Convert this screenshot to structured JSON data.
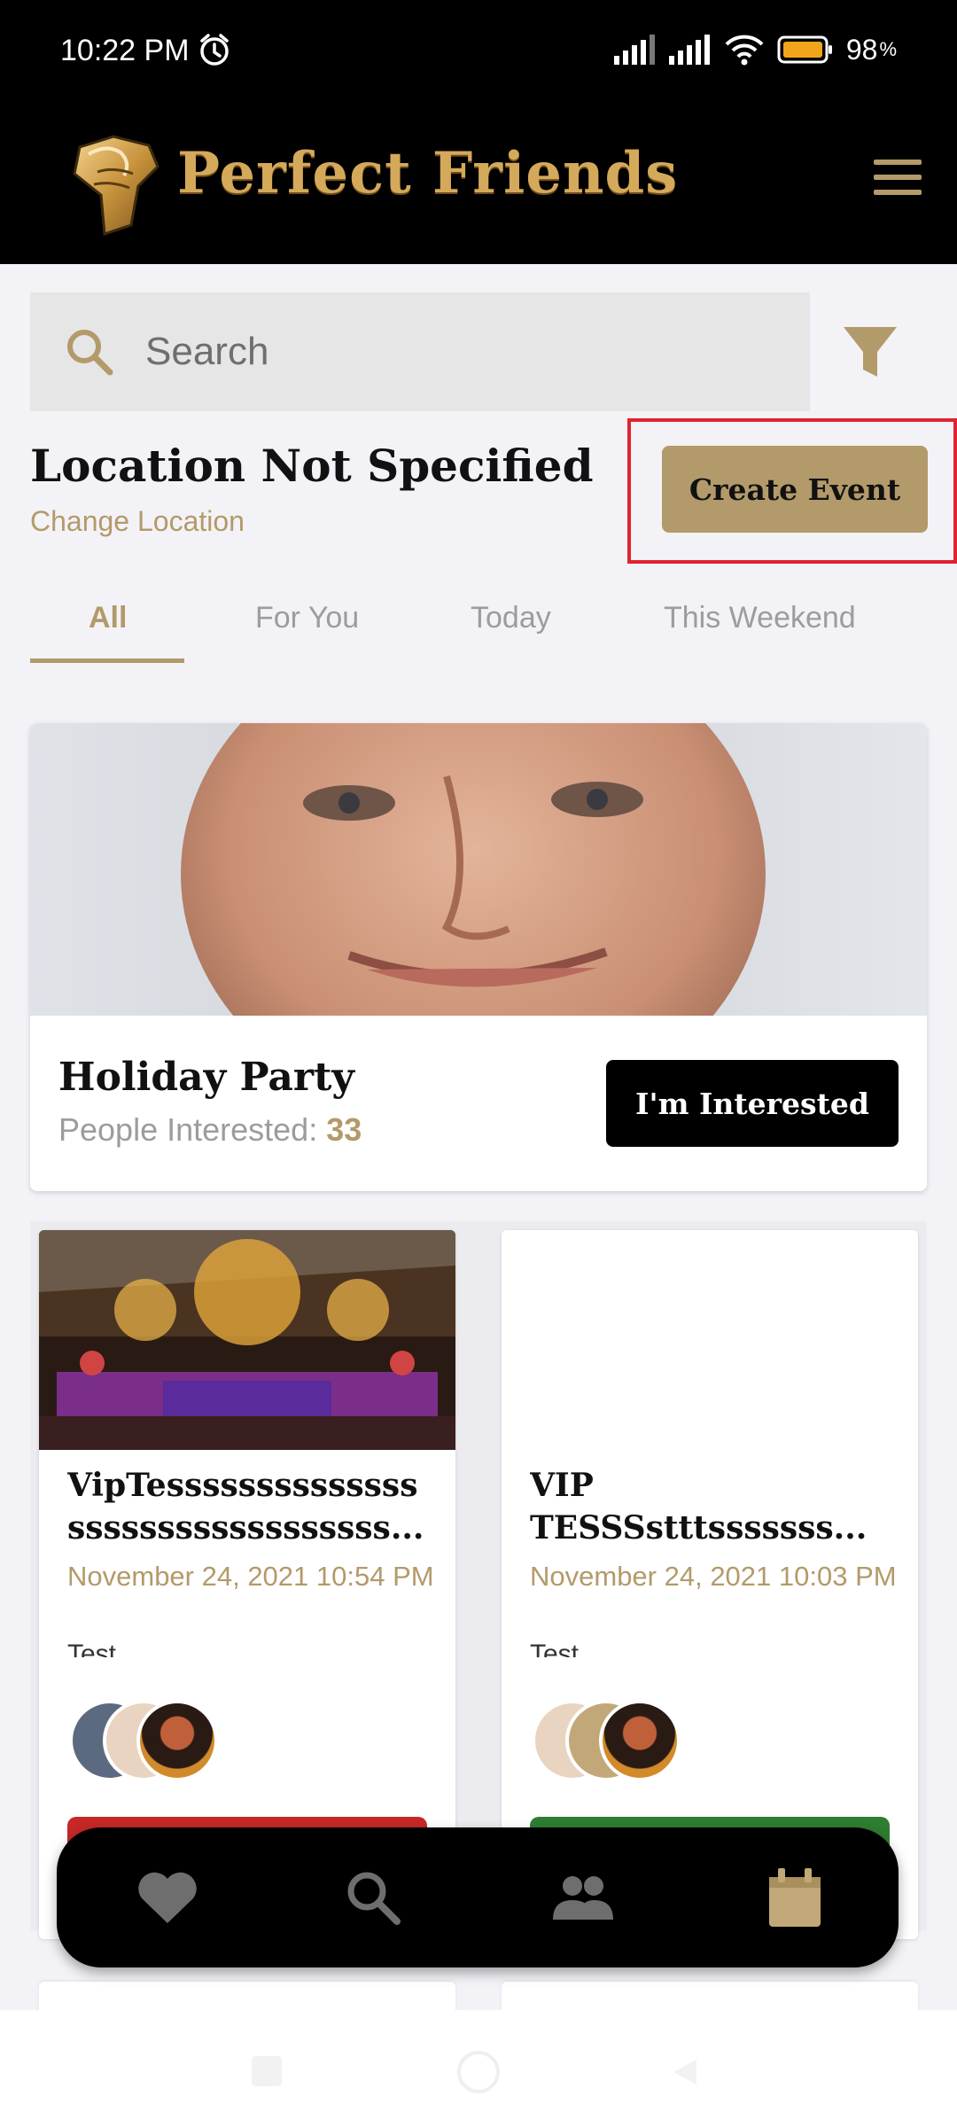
{
  "status_bar": {
    "time": "10:22 PM",
    "battery": "98"
  },
  "app": {
    "title": "Perfect Friends"
  },
  "search": {
    "placeholder": "Search"
  },
  "location": {
    "title": "Location Not Specified",
    "change_label": "Change Location"
  },
  "actions": {
    "create_event": "Create Event"
  },
  "tabs": [
    {
      "label": "All",
      "active": true
    },
    {
      "label": "For You",
      "active": false
    },
    {
      "label": "Today",
      "active": false
    },
    {
      "label": "This Weekend",
      "active": false
    }
  ],
  "featured": {
    "title": "Holiday Party",
    "interest_label": "People Interested: ",
    "interest_count": "33",
    "button_label": "I'm Interested"
  },
  "events": [
    {
      "title_line1": "VipTessssssssssssss",
      "title_line2": "ssssssssssssssssss...",
      "date": "November 24, 2021 10:54 PM",
      "desc": "Test",
      "action_color": "#c62828"
    },
    {
      "title_line1": "VIP",
      "title_line2": "TESSSstttsssssss...",
      "date": "November 24, 2021 10:03 PM",
      "desc": "Test",
      "action_color": "#2e7d32"
    }
  ],
  "colors": {
    "accent": "#b39a6a",
    "highlight": "#e0232f",
    "dark": "#000000"
  },
  "bottom_nav": [
    "heart-icon",
    "search-icon",
    "people-icon",
    "calendar-icon"
  ]
}
